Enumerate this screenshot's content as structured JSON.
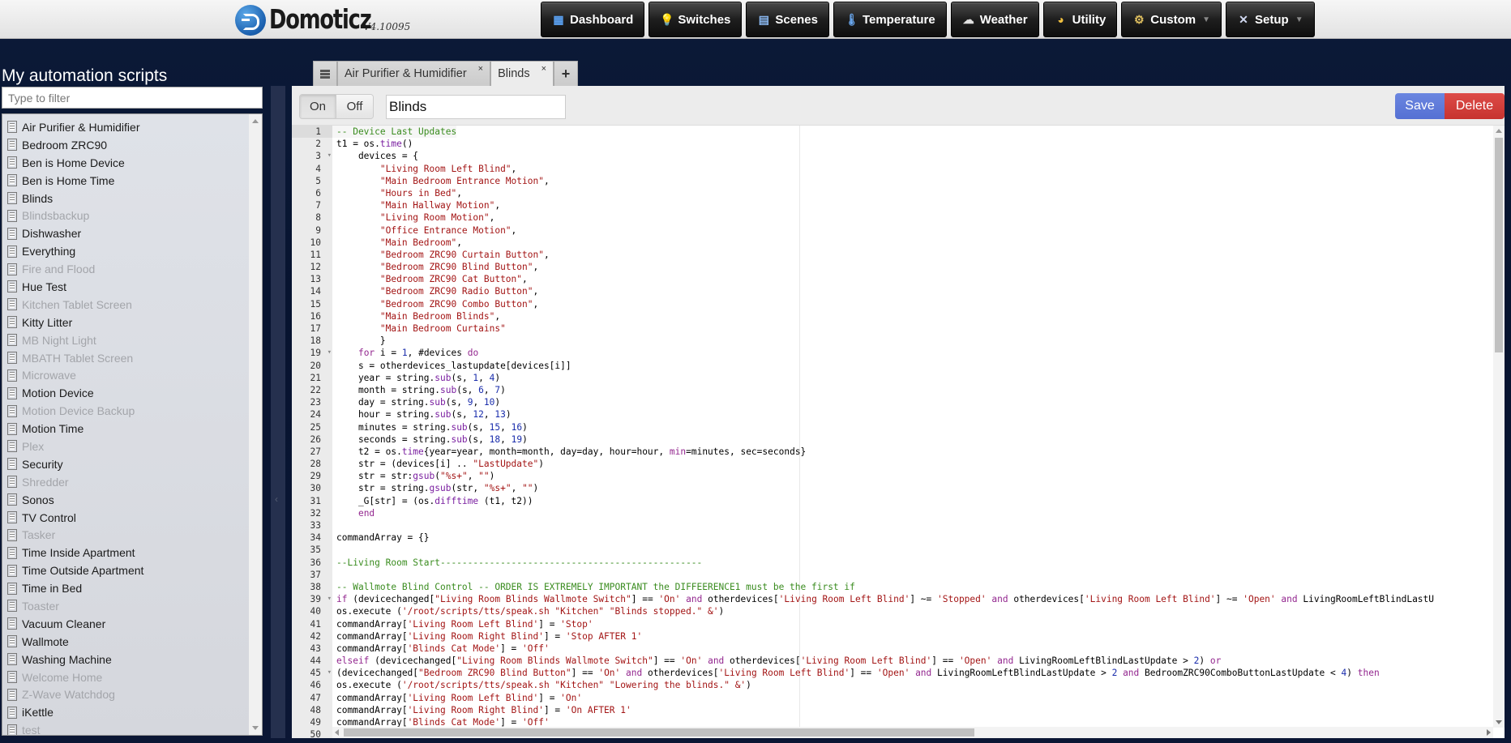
{
  "header": {
    "logo_text": "Domoticz",
    "version": "V4.10095",
    "nav": [
      {
        "label": "Dashboard",
        "icon": "dashboard-icon",
        "glyph": "▦",
        "color": "#5aa0f0",
        "dropdown": false
      },
      {
        "label": "Switches",
        "icon": "lightbulb-icon",
        "glyph": "💡",
        "color": "#f0e050",
        "dropdown": false
      },
      {
        "label": "Scenes",
        "icon": "scenes-icon",
        "glyph": "▤",
        "color": "#8ab8f0",
        "dropdown": false
      },
      {
        "label": "Temperature",
        "icon": "thermometer-icon",
        "glyph": "🌡",
        "color": "#6aa8f0",
        "dropdown": false
      },
      {
        "label": "Weather",
        "icon": "weather-icon",
        "glyph": "☁",
        "color": "#e0e0e0",
        "dropdown": false
      },
      {
        "label": "Utility",
        "icon": "utility-icon",
        "glyph": "◕",
        "color": "#f0c040",
        "dropdown": false
      },
      {
        "label": "Custom",
        "icon": "gear-icon",
        "glyph": "⚙",
        "color": "#e0c060",
        "dropdown": true
      },
      {
        "label": "Setup",
        "icon": "tools-icon",
        "glyph": "✕",
        "color": "#d0d8f0",
        "dropdown": true
      }
    ]
  },
  "sidebar": {
    "title": "My automation scripts",
    "filter_placeholder": "Type to filter",
    "filter_value": "",
    "scripts": [
      {
        "name": "Air Purifier & Humidifier",
        "active": true
      },
      {
        "name": "Bedroom ZRC90",
        "active": true
      },
      {
        "name": "Ben is Home Device",
        "active": true
      },
      {
        "name": "Ben is Home Time",
        "active": true
      },
      {
        "name": "Blinds",
        "active": true
      },
      {
        "name": "Blindsbackup",
        "active": false
      },
      {
        "name": "Dishwasher",
        "active": true
      },
      {
        "name": "Everything",
        "active": true
      },
      {
        "name": "Fire and Flood",
        "active": false
      },
      {
        "name": "Hue Test",
        "active": true
      },
      {
        "name": "Kitchen Tablet Screen",
        "active": false
      },
      {
        "name": "Kitty Litter",
        "active": true
      },
      {
        "name": "MB Night Light",
        "active": false
      },
      {
        "name": "MBATH Tablet Screen",
        "active": false
      },
      {
        "name": "Microwave",
        "active": false
      },
      {
        "name": "Motion Device",
        "active": true
      },
      {
        "name": "Motion Device Backup",
        "active": false
      },
      {
        "name": "Motion Time",
        "active": true
      },
      {
        "name": "Plex",
        "active": false
      },
      {
        "name": "Security",
        "active": true
      },
      {
        "name": "Shredder",
        "active": false
      },
      {
        "name": "Sonos",
        "active": true
      },
      {
        "name": "TV Control",
        "active": true
      },
      {
        "name": "Tasker",
        "active": false
      },
      {
        "name": "Time Inside Apartment",
        "active": true
      },
      {
        "name": "Time Outside Apartment",
        "active": true
      },
      {
        "name": "Time in Bed",
        "active": true
      },
      {
        "name": "Toaster",
        "active": false
      },
      {
        "name": "Vacuum Cleaner",
        "active": true
      },
      {
        "name": "Wallmote",
        "active": true
      },
      {
        "name": "Washing Machine",
        "active": true
      },
      {
        "name": "Welcome Home",
        "active": false
      },
      {
        "name": "Z-Wave Watchdog",
        "active": false
      },
      {
        "name": "iKettle",
        "active": true
      },
      {
        "name": "test",
        "active": false
      }
    ]
  },
  "editor": {
    "tabs": [
      {
        "label": "Air Purifier & Humidifier",
        "active": false,
        "close": "×"
      },
      {
        "label": "Blinds",
        "active": true,
        "close": "×"
      }
    ],
    "add_tab_label": "+",
    "toggle": {
      "on_label": "On",
      "off_label": "Off",
      "state": "On"
    },
    "script_name": "Blinds",
    "save_label": "Save",
    "delete_label": "Delete",
    "current_line": 1,
    "fold_lines": [
      3,
      19,
      39,
      45
    ],
    "code_lines": [
      "-- Device Last Updates",
      "t1 = os.time()",
      "    devices = {",
      "        \"Living Room Left Blind\",",
      "        \"Main Bedroom Entrance Motion\",",
      "        \"Hours in Bed\",",
      "        \"Main Hallway Motion\",",
      "        \"Living Room Motion\",",
      "        \"Office Entrance Motion\",",
      "        \"Main Bedroom\",",
      "        \"Bedroom ZRC90 Curtain Button\",",
      "        \"Bedroom ZRC90 Blind Button\",",
      "        \"Bedroom ZRC90 Cat Button\",",
      "        \"Bedroom ZRC90 Radio Button\",",
      "        \"Bedroom ZRC90 Combo Button\",",
      "        \"Main Bedroom Blinds\",",
      "        \"Main Bedroom Curtains\"",
      "        }",
      "    for i = 1, #devices do",
      "    s = otherdevices_lastupdate[devices[i]]",
      "    year = string.sub(s, 1, 4)",
      "    month = string.sub(s, 6, 7)",
      "    day = string.sub(s, 9, 10)",
      "    hour = string.sub(s, 12, 13)",
      "    minutes = string.sub(s, 15, 16)",
      "    seconds = string.sub(s, 18, 19)",
      "    t2 = os.time{year=year, month=month, day=day, hour=hour, min=minutes, sec=seconds}",
      "    str = (devices[i] .. \"LastUpdate\")",
      "    str = str:gsub(\"%s+\", \"\")",
      "    str = string.gsub(str, \"%s+\", \"\")",
      "    _G[str] = (os.difftime (t1, t2))",
      "    end",
      "",
      "commandArray = {}",
      "",
      "--Living Room Start------------------------------------------------",
      "",
      "-- Wallmote Blind Control -- ORDER IS EXTREMELY IMPORTANT the DIFFEERENCE1 must be the first if",
      "if (devicechanged[\"Living Room Blinds Wallmote Switch\"] == 'On' and otherdevices['Living Room Left Blind'] ~= 'Stopped' and otherdevices['Living Room Left Blind'] ~= 'Open' and LivingRoomLeftBlindLastU",
      "os.execute ('/root/scripts/tts/speak.sh \"Kitchen\" \"Blinds stopped.\" &')",
      "commandArray['Living Room Left Blind'] = 'Stop'",
      "commandArray['Living Room Right Blind'] = 'Stop AFTER 1'",
      "commandArray['Blinds Cat Mode'] = 'Off'",
      "elseif (devicechanged[\"Living Room Blinds Wallmote Switch\"] == 'On' and otherdevices['Living Room Left Blind'] == 'Open' and LivingRoomLeftBlindLastUpdate > 2) or",
      "(devicechanged[\"Bedroom ZRC90 Blind Button\"] == 'On' and otherdevices['Living Room Left Blind'] == 'Open' and LivingRoomLeftBlindLastUpdate > 2 and BedroomZRC90ComboButtonLastUpdate < 4) then",
      "os.execute ('/root/scripts/tts/speak.sh \"Kitchen\" \"Lowering the blinds.\" &')",
      "commandArray['Living Room Left Blind'] = 'On'",
      "commandArray['Living Room Right Blind'] = 'On AFTER 1'",
      "commandArray['Blinds Cat Mode'] = 'Off'",
      ""
    ]
  }
}
